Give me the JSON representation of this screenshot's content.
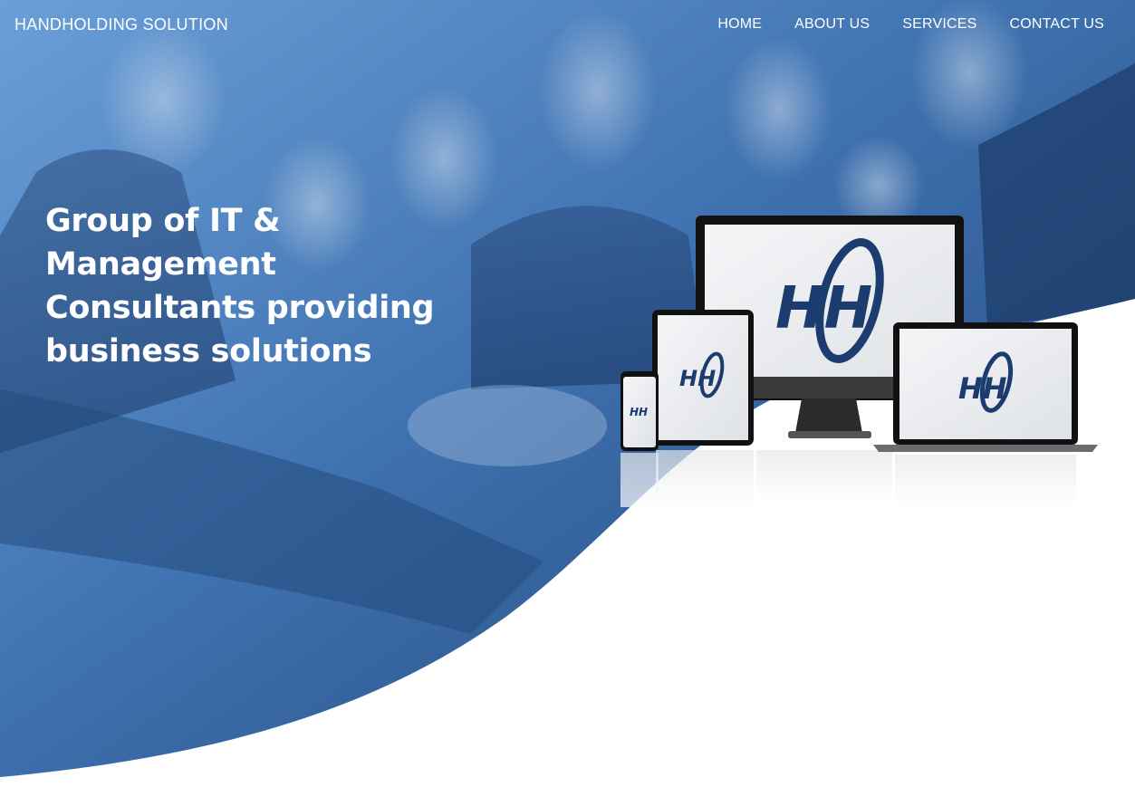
{
  "header": {
    "brand": "HANDHOLDING SOLUTION",
    "nav": [
      "HOME",
      "ABOUT US",
      "SERVICES",
      "CONTACT US"
    ]
  },
  "hero": {
    "headline": "Group of IT & Management Consultants providing business solutions",
    "background_subject": "team-stacking-hands-photo",
    "overlay_color": "#2d5f9e",
    "wave_color": "#ffffff"
  },
  "devices": {
    "logo_text": "HH",
    "logo_colors": [
      "#1c3b6e",
      "#2b8de8"
    ]
  }
}
